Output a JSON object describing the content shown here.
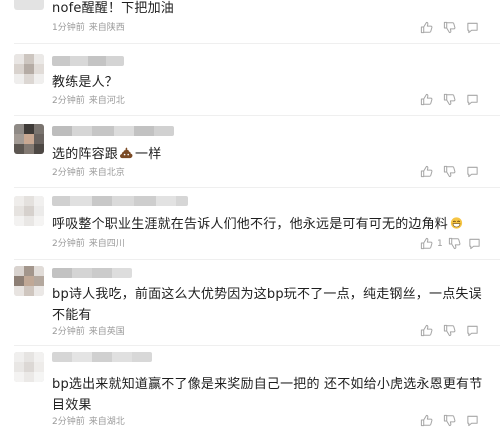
{
  "comments": [
    {
      "text": "nofe醒醒！下把加油",
      "time": "1分钟前",
      "location": "来自陕西",
      "likes": ""
    },
    {
      "text": "教练是人？",
      "time": "2分钟前",
      "location": "来自河北",
      "likes": ""
    },
    {
      "text_before": "选的阵容跟",
      "emoji": "poop-emoji",
      "text_after": "一样",
      "time": "2分钟前",
      "location": "来自北京",
      "likes": ""
    },
    {
      "text": "呼吸整个职业生涯就在告诉人们他不行，他永远是可有可无的边角料",
      "emoji": "grin-emoji",
      "time": "2分钟前",
      "location": "来自四川",
      "likes": "1"
    },
    {
      "text": "bp诗人我吃，前面这么大优势因为这bp玩不了一点，纯走钢丝，一点失误不能有",
      "time": "2分钟前",
      "location": "来自英国",
      "likes": ""
    },
    {
      "text": "bp选出来就知道赢不了像是来奖励自己一把的 还不如给小虎选永恩更有节目效果",
      "time": "2分钟前",
      "location": "来自湖北",
      "likes": ""
    }
  ],
  "colors": {
    "text": "#1e1e1e",
    "meta": "#9a9a9a",
    "divider": "#efefef",
    "background": "#ffffff"
  },
  "icons": {
    "like": "thumb-up-icon",
    "dislike": "thumb-down-icon",
    "reply": "comment-bubble-icon"
  }
}
